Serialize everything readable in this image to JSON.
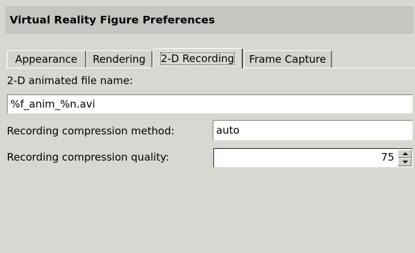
{
  "header": {
    "title": "Virtual Reality Figure Preferences"
  },
  "tabs": [
    {
      "label": "Appearance"
    },
    {
      "label": "Rendering"
    },
    {
      "label": "2-D Recording"
    },
    {
      "label": "Frame Capture"
    }
  ],
  "active_tab": "2-D Recording",
  "fields": {
    "file_name_label": "2-D animated file name:",
    "file_name_value": "%f_anim_%n.avi",
    "compression_method_label": "Recording compression method:",
    "compression_method_value": "auto",
    "compression_quality_label": "Recording compression quality:",
    "compression_quality_value": "75"
  }
}
